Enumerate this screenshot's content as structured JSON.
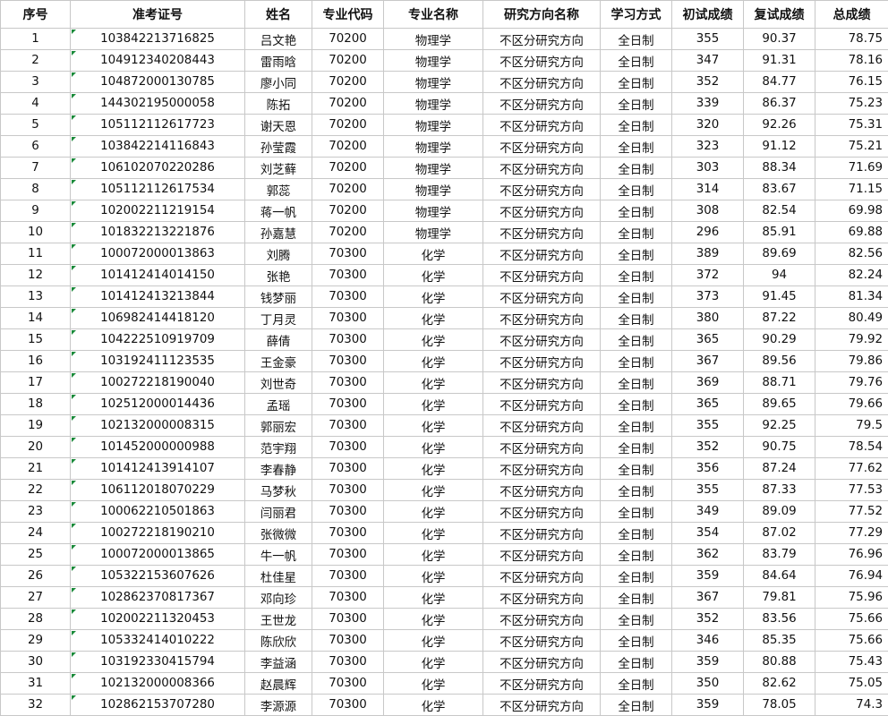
{
  "headers": [
    "序号",
    "准考证号",
    "姓名",
    "专业代码",
    "专业名称",
    "研究方向名称",
    "学习方式",
    "初试成绩",
    "复试成绩",
    "总成绩"
  ],
  "rows": [
    [
      "1",
      "103842213716825",
      "吕文艳",
      "70200",
      "物理学",
      "不区分研究方向",
      "全日制",
      "355",
      "90.37",
      "78.75"
    ],
    [
      "2",
      "104912340208443",
      "雷雨晗",
      "70200",
      "物理学",
      "不区分研究方向",
      "全日制",
      "347",
      "91.31",
      "78.16"
    ],
    [
      "3",
      "104872000130785",
      "廖小同",
      "70200",
      "物理学",
      "不区分研究方向",
      "全日制",
      "352",
      "84.77",
      "76.15"
    ],
    [
      "4",
      "144302195000058",
      "陈拓",
      "70200",
      "物理学",
      "不区分研究方向",
      "全日制",
      "339",
      "86.37",
      "75.23"
    ],
    [
      "5",
      "105112112617723",
      "谢天恩",
      "70200",
      "物理学",
      "不区分研究方向",
      "全日制",
      "320",
      "92.26",
      "75.31"
    ],
    [
      "6",
      "103842214116843",
      "孙莹霞",
      "70200",
      "物理学",
      "不区分研究方向",
      "全日制",
      "323",
      "91.12",
      "75.21"
    ],
    [
      "7",
      "106102070220286",
      "刘芝藓",
      "70200",
      "物理学",
      "不区分研究方向",
      "全日制",
      "303",
      "88.34",
      "71.69"
    ],
    [
      "8",
      "105112112617534",
      "郭蕊",
      "70200",
      "物理学",
      "不区分研究方向",
      "全日制",
      "314",
      "83.67",
      "71.15"
    ],
    [
      "9",
      "102002211219154",
      "蒋一帆",
      "70200",
      "物理学",
      "不区分研究方向",
      "全日制",
      "308",
      "82.54",
      "69.98"
    ],
    [
      "10",
      "101832213221876",
      "孙嘉慧",
      "70200",
      "物理学",
      "不区分研究方向",
      "全日制",
      "296",
      "85.91",
      "69.88"
    ],
    [
      "11",
      "100072000013863",
      "刘腾",
      "70300",
      "化学",
      "不区分研究方向",
      "全日制",
      "389",
      "89.69",
      "82.56"
    ],
    [
      "12",
      "101412414014150",
      "张艳",
      "70300",
      "化学",
      "不区分研究方向",
      "全日制",
      "372",
      "94",
      "82.24"
    ],
    [
      "13",
      "101412413213844",
      "钱梦丽",
      "70300",
      "化学",
      "不区分研究方向",
      "全日制",
      "373",
      "91.45",
      "81.34"
    ],
    [
      "14",
      "106982414418120",
      "丁月灵",
      "70300",
      "化学",
      "不区分研究方向",
      "全日制",
      "380",
      "87.22",
      "80.49"
    ],
    [
      "15",
      "104222510919709",
      "薛倩",
      "70300",
      "化学",
      "不区分研究方向",
      "全日制",
      "365",
      "90.29",
      "79.92"
    ],
    [
      "16",
      "103192411123535",
      "王金豪",
      "70300",
      "化学",
      "不区分研究方向",
      "全日制",
      "367",
      "89.56",
      "79.86"
    ],
    [
      "17",
      "100272218190040",
      "刘世奇",
      "70300",
      "化学",
      "不区分研究方向",
      "全日制",
      "369",
      "88.71",
      "79.76"
    ],
    [
      "18",
      "102512000014436",
      "孟瑶",
      "70300",
      "化学",
      "不区分研究方向",
      "全日制",
      "365",
      "89.65",
      "79.66"
    ],
    [
      "19",
      "102132000008315",
      "郭丽宏",
      "70300",
      "化学",
      "不区分研究方向",
      "全日制",
      "355",
      "92.25",
      "79.5"
    ],
    [
      "20",
      "101452000000988",
      "范宇翔",
      "70300",
      "化学",
      "不区分研究方向",
      "全日制",
      "352",
      "90.75",
      "78.54"
    ],
    [
      "21",
      "101412413914107",
      "李春静",
      "70300",
      "化学",
      "不区分研究方向",
      "全日制",
      "356",
      "87.24",
      "77.62"
    ],
    [
      "22",
      "106112018070229",
      "马梦秋",
      "70300",
      "化学",
      "不区分研究方向",
      "全日制",
      "355",
      "87.33",
      "77.53"
    ],
    [
      "23",
      "100062210501863",
      "闫丽君",
      "70300",
      "化学",
      "不区分研究方向",
      "全日制",
      "349",
      "89.09",
      "77.52"
    ],
    [
      "24",
      "100272218190210",
      "张微微",
      "70300",
      "化学",
      "不区分研究方向",
      "全日制",
      "354",
      "87.02",
      "77.29"
    ],
    [
      "25",
      "100072000013865",
      "牛一帆",
      "70300",
      "化学",
      "不区分研究方向",
      "全日制",
      "362",
      "83.79",
      "76.96"
    ],
    [
      "26",
      "105322153607626",
      "杜佳星",
      "70300",
      "化学",
      "不区分研究方向",
      "全日制",
      "359",
      "84.64",
      "76.94"
    ],
    [
      "27",
      "102862370817367",
      "邓向珍",
      "70300",
      "化学",
      "不区分研究方向",
      "全日制",
      "367",
      "79.81",
      "75.96"
    ],
    [
      "28",
      "102002211320453",
      "王世龙",
      "70300",
      "化学",
      "不区分研究方向",
      "全日制",
      "352",
      "83.56",
      "75.66"
    ],
    [
      "29",
      "105332414010222",
      "陈欣欣",
      "70300",
      "化学",
      "不区分研究方向",
      "全日制",
      "346",
      "85.35",
      "75.66"
    ],
    [
      "30",
      "103192330415794",
      "李益涵",
      "70300",
      "化学",
      "不区分研究方向",
      "全日制",
      "359",
      "80.88",
      "75.43"
    ],
    [
      "31",
      "102132000008366",
      "赵晨辉",
      "70300",
      "化学",
      "不区分研究方向",
      "全日制",
      "350",
      "82.62",
      "75.05"
    ],
    [
      "32",
      "102862153707280",
      "李源源",
      "70300",
      "化学",
      "不区分研究方向",
      "全日制",
      "359",
      "78.05",
      "74.3"
    ]
  ]
}
